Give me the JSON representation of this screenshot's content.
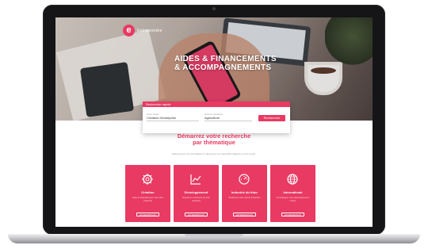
{
  "site": {
    "logo_mark": "e",
    "logo_text": "Entreprendre"
  },
  "hero": {
    "headline_line1": "AIDES & FINANCEMENTS",
    "headline_line2": "& ACCOMPAGNEMENTS"
  },
  "search": {
    "header_label": "Recherche rapide",
    "field1_label": "Votre projet",
    "field1_value": "Création d'entreprise",
    "field2_label": "Secteur d'activité",
    "field2_value": "Agriculture",
    "button_label": "Rechercher"
  },
  "section": {
    "title_line1": "Démarrez votre recherche",
    "title_line2": "par thématique",
    "subtitle": "Sélectionnez une thématique et découvrez les dispositifs adaptés à votre projet."
  },
  "cards": [
    {
      "name": "Création",
      "desc": "Aides et dispositifs pour créer votre entreprise",
      "button": "EN SAVOIR PLUS",
      "icon": "gear-icon"
    },
    {
      "name": "Développement",
      "desc": "Financer la croissance de votre entreprise",
      "button": "EN SAVOIR PLUS",
      "icon": "chart-icon"
    },
    {
      "name": "Industrie du futur",
      "desc": "Moderniser votre outil de production",
      "button": "EN SAVOIR PLUS",
      "icon": "dial-icon"
    },
    {
      "name": "International",
      "desc": "Accompagner votre développement à l'export",
      "button": "EN SAVOIR PLUS",
      "icon": "globe-icon"
    }
  ],
  "colors": {
    "brand": "#e83a63"
  }
}
